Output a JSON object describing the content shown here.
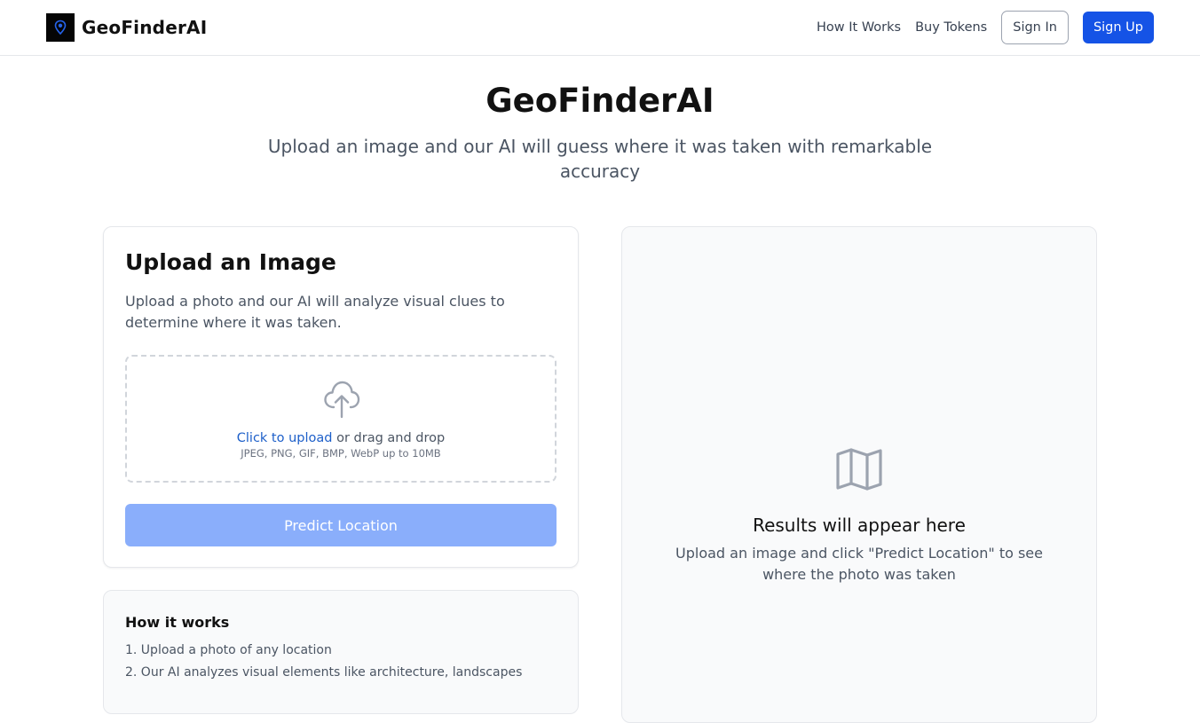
{
  "header": {
    "brand": "GeoFinderAI",
    "nav": {
      "how_it_works": "How It Works",
      "buy_tokens": "Buy Tokens",
      "sign_in": "Sign In",
      "sign_up": "Sign Up"
    }
  },
  "hero": {
    "title": "GeoFinderAI",
    "subtitle": "Upload an image and our AI will guess where it was taken with remarkable accuracy"
  },
  "upload": {
    "title": "Upload an Image",
    "description": "Upload a photo and our AI will analyze visual clues to determine where it was taken.",
    "click_link": "Click to upload",
    "drag_text": " or drag and drop",
    "formats": "JPEG, PNG, GIF, BMP, WebP up to 10MB",
    "predict_button": "Predict Location"
  },
  "how_it_works": {
    "title": "How it works",
    "steps": [
      "1. Upload a photo of any location",
      "2. Our AI analyzes visual elements like architecture, landscapes"
    ]
  },
  "results": {
    "title": "Results will appear here",
    "description": "Upload an image and click \"Predict Location\" to see where the photo was taken"
  },
  "icons": {
    "logo": "map-pin-icon",
    "upload": "cloud-upload-icon",
    "results": "map-icon"
  },
  "colors": {
    "primary": "#1553e6",
    "primary_disabled": "#8aaefb",
    "link": "#1d5fc9",
    "logo_bg": "#050505",
    "logo_accent": "#2563eb"
  }
}
